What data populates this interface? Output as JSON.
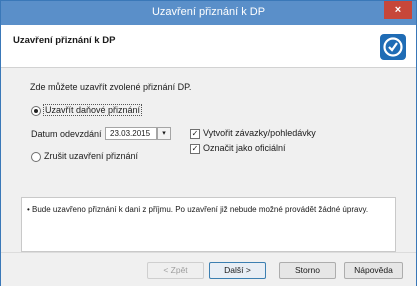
{
  "window": {
    "title": "Uzavření přiznání k DP",
    "close_glyph": "×"
  },
  "header": {
    "title": "Uzavření přiznání k DP",
    "logo_icon": "app-logo-icon"
  },
  "content": {
    "intro": "Zde můžete uzavřít zvolené přiznání DP.",
    "radio_close": {
      "label": "Uzavřít daňové přiznání",
      "checked": true
    },
    "date_label": "Datum odevzdání",
    "date_value": "23.03.2015",
    "date_dropdown_glyph": "▾",
    "radio_cancel": {
      "label": "Zrušit uzavření přiznání",
      "checked": false
    },
    "check_obligations": {
      "label": "Vytvořit závazky/pohledávky",
      "checked": true
    },
    "check_official": {
      "label": "Označit jako oficiální",
      "checked": true
    },
    "checkmark": "✓",
    "info_text": "• Bude uzavřeno přiznání k dani z příjmu. Po uzavření již nebude možné provádět žádné úpravy."
  },
  "footer": {
    "back": "< Zpět",
    "next": "Další >",
    "cancel": "Storno",
    "help": "Nápověda"
  },
  "colors": {
    "titlebar": "#5a8fc9",
    "close": "#c7473a",
    "logo": "#1f6cb5"
  }
}
